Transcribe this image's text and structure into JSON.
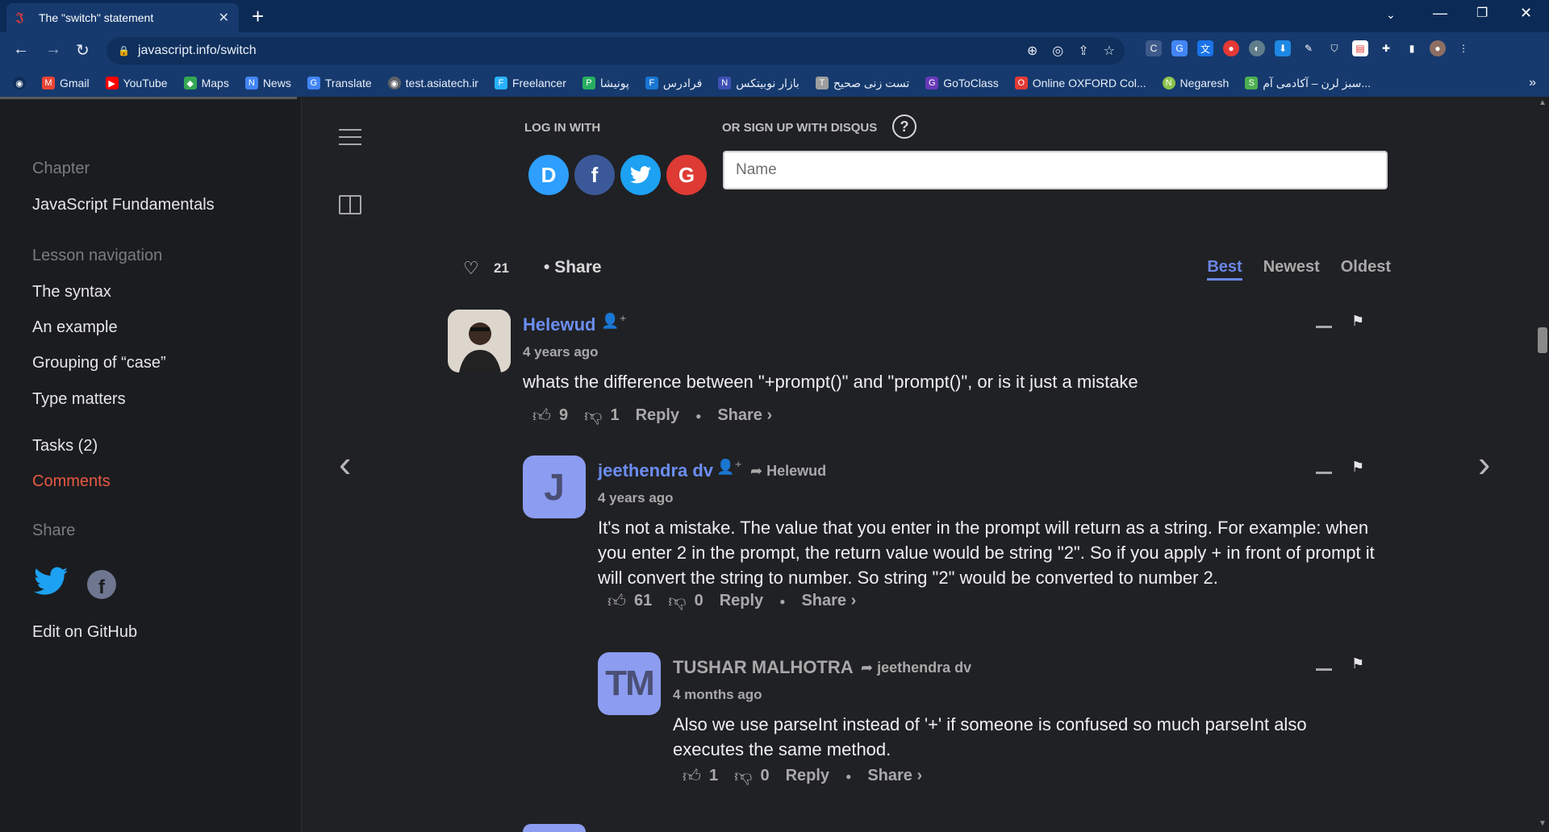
{
  "browser": {
    "tab_title": "The \"switch\" statement",
    "url": "javascript.info/switch",
    "bookmarks": [
      {
        "label": "Gmail",
        "icon": "gmail-icon",
        "color": "#ea4335"
      },
      {
        "label": "YouTube",
        "icon": "youtube-icon",
        "color": "#ff0000"
      },
      {
        "label": "Maps",
        "icon": "maps-icon",
        "color": "#34a853"
      },
      {
        "label": "News",
        "icon": "news-icon",
        "color": "#4285f4"
      },
      {
        "label": "Translate",
        "icon": "translate-icon",
        "color": "#4285f4"
      },
      {
        "label": "test.asiatech.ir",
        "icon": "globe-icon",
        "color": "#5f6368"
      },
      {
        "label": "Freelancer",
        "icon": "freelancer-icon",
        "color": "#29b2fe"
      },
      {
        "label": "پونیشا",
        "icon": "ponisha-icon",
        "color": "#27ae60"
      },
      {
        "label": "فرادرس",
        "icon": "faradars-icon",
        "color": "#1976d2"
      },
      {
        "label": "بازار نوبیتکس",
        "icon": "nobitex-icon",
        "color": "#3f51b5"
      },
      {
        "label": "تست زنی صحیح",
        "icon": "test-icon",
        "color": "#9e9e9e"
      },
      {
        "label": "GoToClass",
        "icon": "gotoclass-icon",
        "color": "#673ab7"
      },
      {
        "label": "Online OXFORD Col...",
        "icon": "oxford-icon",
        "color": "#e53935"
      },
      {
        "label": "Negaresh",
        "icon": "negaresh-icon",
        "color": "#8bc34a"
      },
      {
        "label": "سبز لرن – آکادمی آم...",
        "icon": "sabzlearn-icon",
        "color": "#4caf50"
      }
    ]
  },
  "sidebar": {
    "chapter_label": "Chapter",
    "chapter_title": "JavaScript Fundamentals",
    "lesson_nav_label": "Lesson navigation",
    "lesson_items": [
      "The syntax",
      "An example",
      "Grouping of “case”",
      "Type matters"
    ],
    "tasks": "Tasks (2)",
    "comments": "Comments",
    "share_label": "Share",
    "edit": "Edit on GitHub"
  },
  "disqus": {
    "login_with": "LOG IN WITH",
    "signup_with": "OR SIGN UP WITH DISQUS",
    "help": "?",
    "name_placeholder": "Name",
    "likes": "21",
    "share": "Share",
    "sorts": {
      "best": "Best",
      "newest": "Newest",
      "oldest": "Oldest"
    },
    "social": {
      "disqus": "D",
      "facebook": "f",
      "twitter": "t",
      "google": "G"
    }
  },
  "comments": [
    {
      "author": "Helewud",
      "time": "4 years ago",
      "text": "whats the difference between \"+prompt()\" and \"prompt()\", or is it just a mistake",
      "upvotes": "9",
      "downvotes": "1",
      "reply": "Reply",
      "share": "Share ›"
    },
    {
      "author": "jeethendra dv",
      "avatar_letter": "J",
      "reply_to": "Helewud",
      "time": "4 years ago",
      "text": "It's not a mistake. The value that you enter in the prompt will return as a string. For example: when you enter 2 in the prompt, the return value would be string \"2\". So if you apply + in front of prompt it will convert the string to number. So string \"2\" would be converted to number 2.",
      "upvotes": "61",
      "downvotes": "0",
      "reply": "Reply",
      "share": "Share ›"
    },
    {
      "author": "TUSHAR MALHOTRA",
      "avatar_letter": "TM",
      "reply_to": "jeethendra dv",
      "time": "4 months ago",
      "text": "Also we use parseInt instead of '+' if someone is confused so much parseInt also executes the same method.",
      "upvotes": "1",
      "downvotes": "0",
      "reply": "Reply",
      "share": "Share ›"
    }
  ]
}
